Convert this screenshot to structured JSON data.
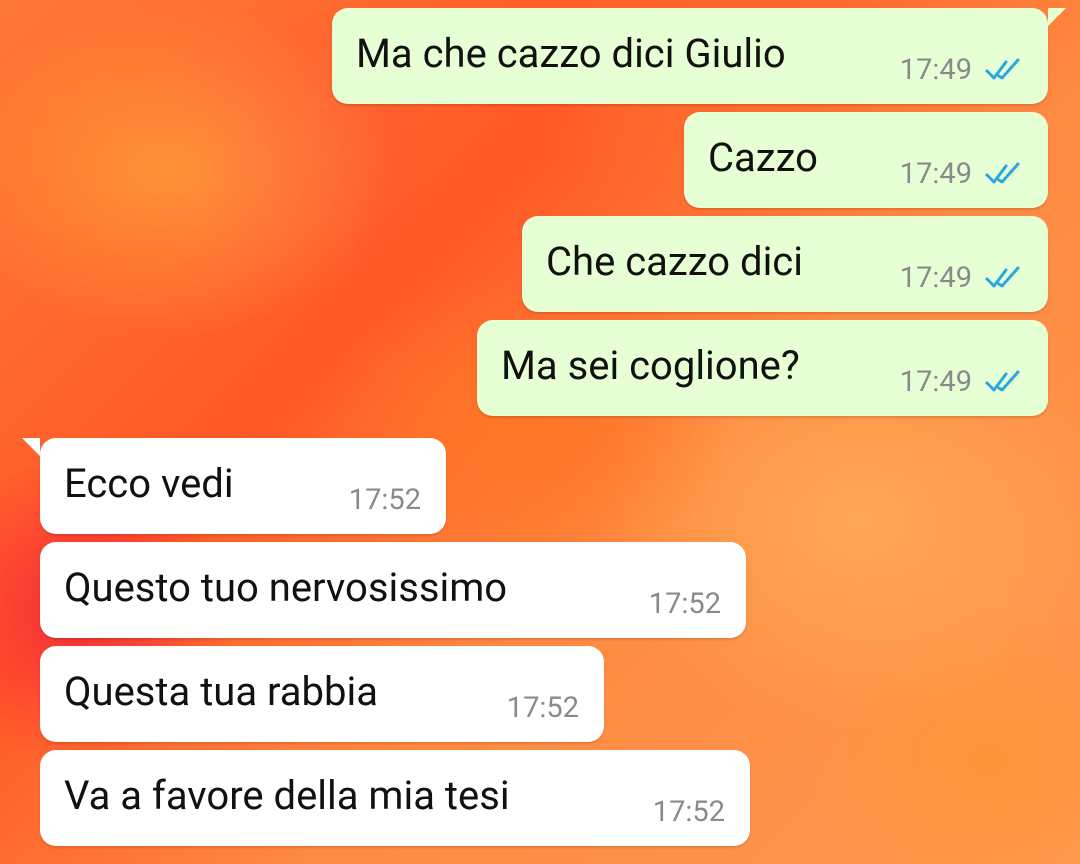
{
  "colors": {
    "outgoing_bubble": "#E6FFD4",
    "incoming_bubble": "#FFFFFF",
    "timestamp": "#8A8A8A",
    "read_ticks": "#2AA7E0"
  },
  "icons": {
    "read_receipt": "double-check-icon"
  },
  "messages": [
    {
      "direction": "outgoing",
      "text": "Ma che cazzo dici Giulio",
      "time": "17:49",
      "status": "read"
    },
    {
      "direction": "outgoing",
      "text": "Cazzo",
      "time": "17:49",
      "status": "read"
    },
    {
      "direction": "outgoing",
      "text": "Che cazzo dici",
      "time": "17:49",
      "status": "read"
    },
    {
      "direction": "outgoing",
      "text": "Ma sei coglione?",
      "time": "17:49",
      "status": "read"
    },
    {
      "direction": "incoming",
      "text": "Ecco vedi",
      "time": "17:52"
    },
    {
      "direction": "incoming",
      "text": "Questo tuo nervosissimo",
      "time": "17:52"
    },
    {
      "direction": "incoming",
      "text": "Questa tua rabbia",
      "time": "17:52"
    },
    {
      "direction": "incoming",
      "text": "Va a favore della mia tesi",
      "time": "17:52"
    }
  ]
}
